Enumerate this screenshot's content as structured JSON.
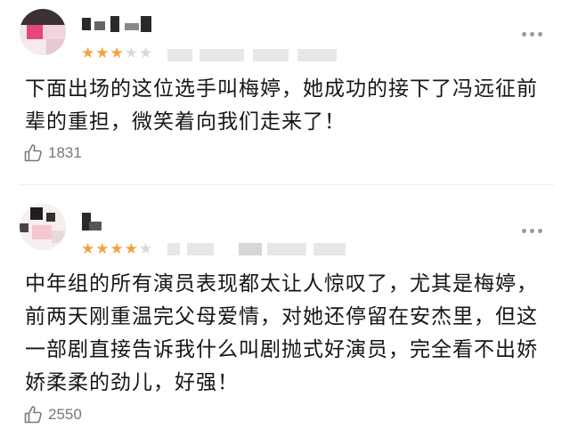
{
  "reviews": [
    {
      "rating": 3,
      "max_rating": 5,
      "content": "下面出场的这位选手叫梅婷，她成功的接下了冯远征前辈的重担，微笑着向我们走来了！",
      "likes": "1831",
      "like_icon": "thumbs-up-icon",
      "more_icon": "more-dots-icon"
    },
    {
      "rating": 4,
      "max_rating": 5,
      "content": "中年组的所有演员表现都太让人惊叹了，尤其是梅婷，前两天刚重温完父母爱情，对她还停留在安杰里，但这一部剧直接告诉我什么叫剧抛式好演员，完全看不出娇娇柔柔的劲儿，好强！",
      "likes": "2550",
      "like_icon": "thumbs-up-icon",
      "more_icon": "more-dots-icon"
    }
  ],
  "colors": {
    "star_active": "#f2a23c",
    "star_inactive": "#d9d9d9",
    "like_text": "#777777"
  }
}
